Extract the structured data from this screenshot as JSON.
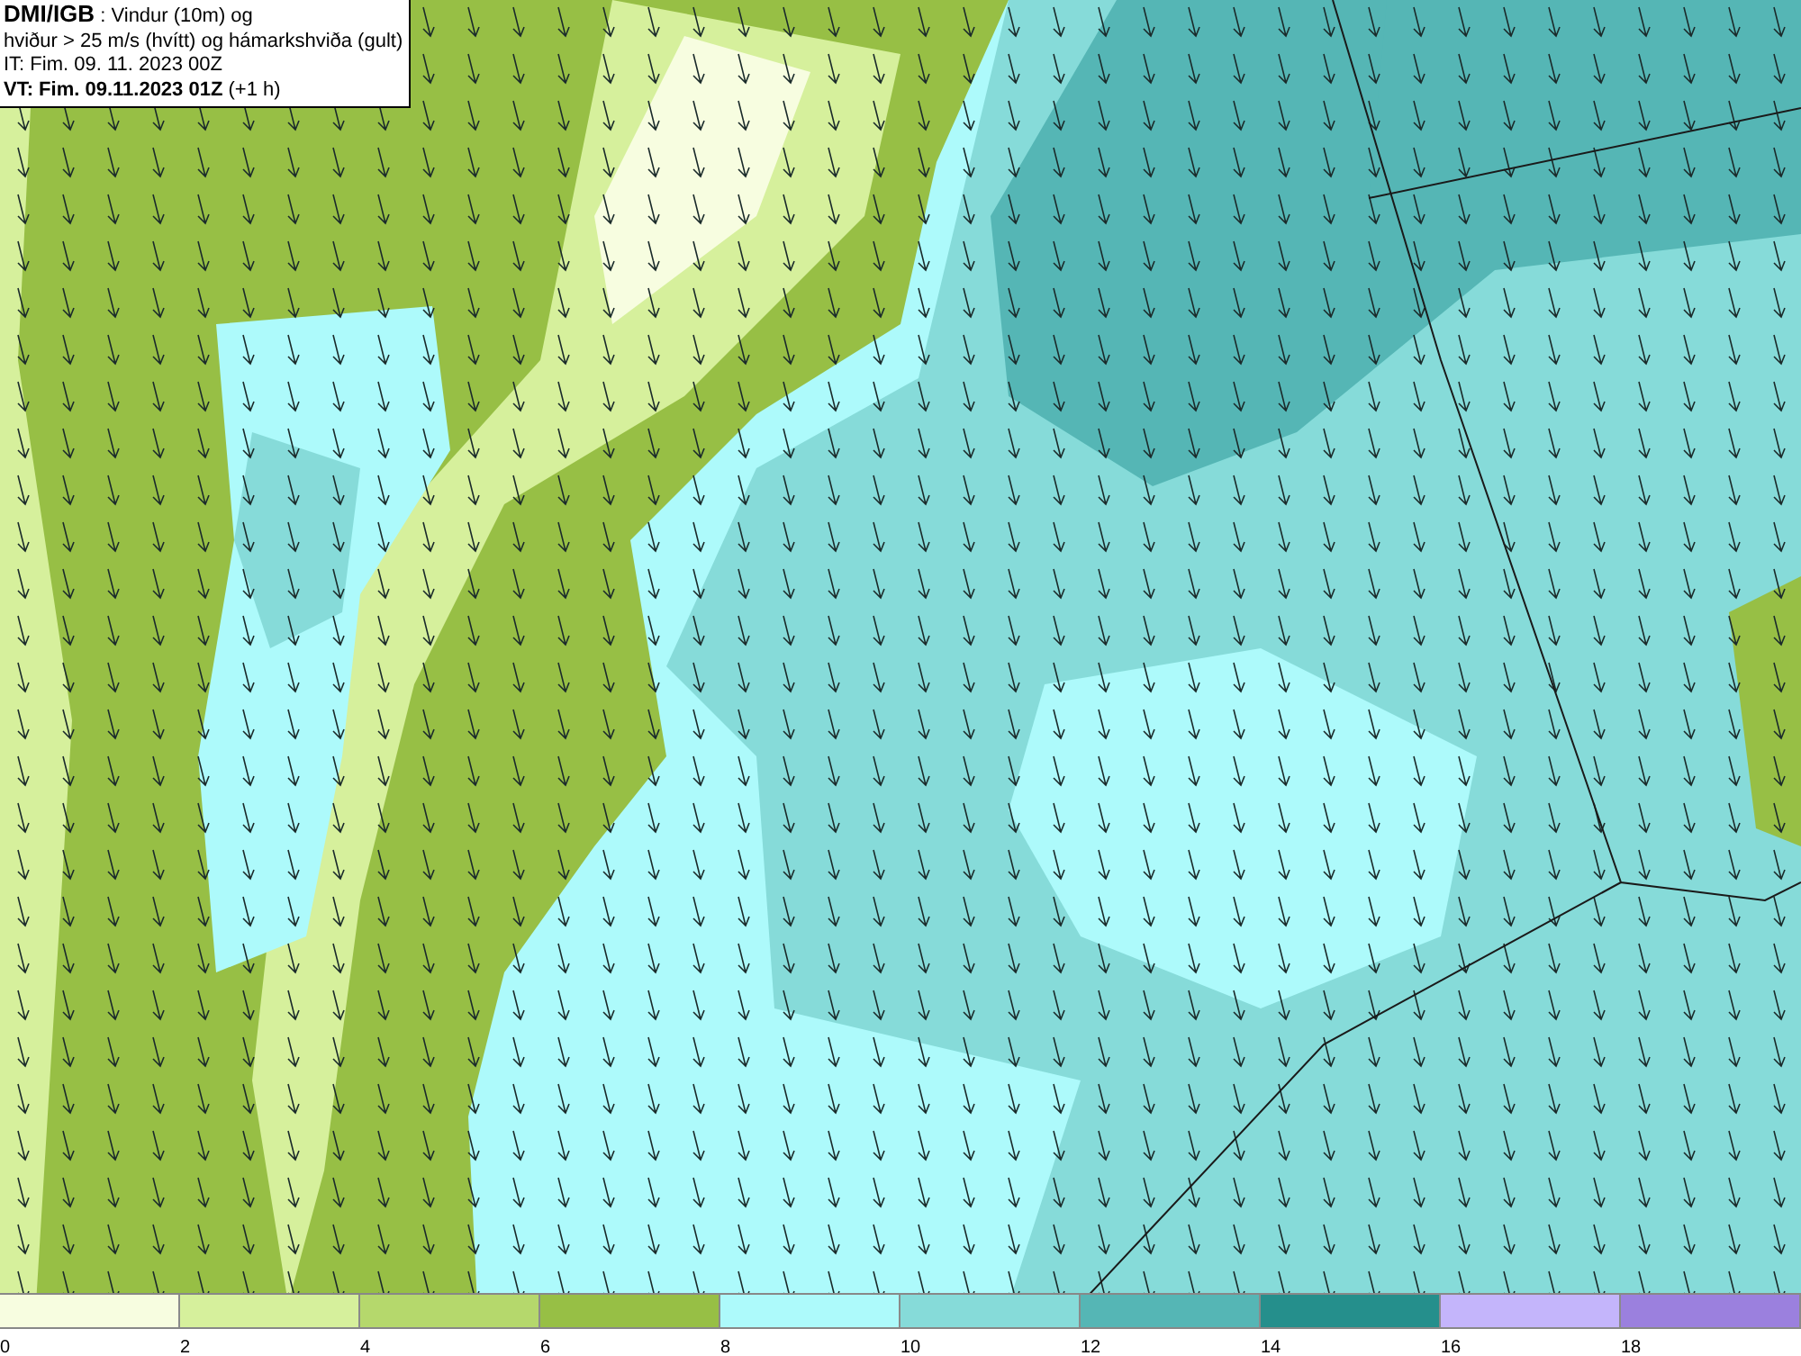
{
  "title_box": {
    "lines": [
      "**DMI/IGB** : Vindur (10m) og",
      "hviður > 25 m/s (hvítt) og hámarkshviða (gult)",
      "IT: Fim. 09. 11. 2023 00Z",
      "**VT: Fim. 09.11.2023 01Z** (+1 h)"
    ]
  },
  "legend": {
    "segments": [
      {
        "label": "0",
        "color": "#f7fde0"
      },
      {
        "label": "2",
        "color": "#d6f09c"
      },
      {
        "label": "4",
        "color": "#b5d86c"
      },
      {
        "label": "6",
        "color": "#97bf45"
      },
      {
        "label": "8",
        "color": "#adfafb"
      },
      {
        "label": "10",
        "color": "#86dbd9"
      },
      {
        "label": "12",
        "color": "#55b6b5"
      },
      {
        "label": "14",
        "color": "#258f8c"
      },
      {
        "label": "16",
        "color": "#c4b5fb"
      },
      {
        "label": "18",
        "color": "#9b80de"
      }
    ]
  }
}
